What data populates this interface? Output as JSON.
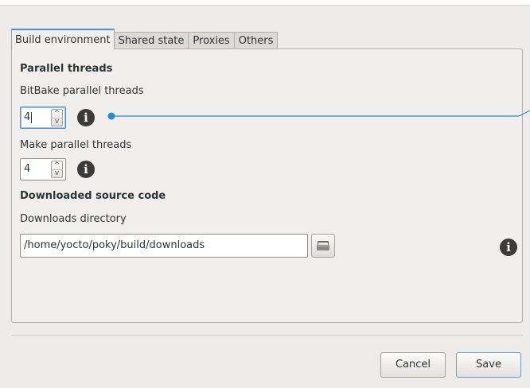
{
  "tabs": [
    {
      "label": "Build environment",
      "active": true
    },
    {
      "label": "Shared state",
      "active": false
    },
    {
      "label": "Proxies",
      "active": false
    },
    {
      "label": "Others",
      "active": false
    }
  ],
  "parallel": {
    "heading": "Parallel threads",
    "bitbake_label": "BitBake parallel threads",
    "bitbake_value": "4",
    "make_label": "Make parallel threads",
    "make_value": "4"
  },
  "downloads": {
    "heading": "Downloaded source code",
    "dir_label": "Downloads directory",
    "dir_value": "/home/yocto/poky/build/downloads"
  },
  "icons": {
    "info": "i",
    "spin_up": "^",
    "spin_down": "v"
  },
  "buttons": {
    "cancel": "Cancel",
    "save": "Save"
  },
  "colors": {
    "accent": "#4a90d9",
    "pointer_line": "#1f8fd6"
  }
}
